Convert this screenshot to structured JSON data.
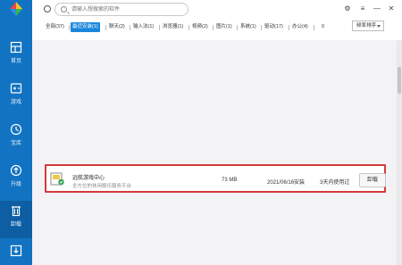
{
  "sidebar": {
    "items": [
      {
        "label": "首页",
        "icon": "home-icon"
      },
      {
        "label": "游戏",
        "icon": "gamepad-icon"
      },
      {
        "label": "宝库",
        "icon": "treasure-icon"
      },
      {
        "label": "升级",
        "icon": "upgrade-icon"
      },
      {
        "label": "卸载",
        "icon": "trash-icon",
        "active": true
      },
      {
        "label": "",
        "icon": "download-icon"
      }
    ]
  },
  "search": {
    "placeholder": "请输入想搜索的软件"
  },
  "window": {
    "settings_icon": "⚙",
    "menu_icon": "≡",
    "minimize_icon": "—",
    "close_icon": "✕"
  },
  "tabs": [
    {
      "label": "全部(37)"
    },
    {
      "label": "最近安装(1)",
      "active": true
    },
    {
      "label": "聊天(2)"
    },
    {
      "label": "输入法(1)"
    },
    {
      "label": "浏览器(1)"
    },
    {
      "label": "视频(2)"
    },
    {
      "label": "图片(1)"
    },
    {
      "label": "系统(1)"
    },
    {
      "label": "驱动(17)"
    },
    {
      "label": "办公(4)"
    },
    {
      "label": "0"
    }
  ],
  "sort": {
    "label": "频率排序"
  },
  "app": {
    "name": "远航游戏中心",
    "desc": "全方位的休闲娱乐服务平台",
    "size": "73 MB",
    "install_date": "2021/06/16安装",
    "last_used": "3天内使用过",
    "uninstall_label": "卸载"
  },
  "colors": {
    "sidebar": "#1273c2",
    "accent": "#1a87de",
    "highlight": "#d53a3a"
  }
}
